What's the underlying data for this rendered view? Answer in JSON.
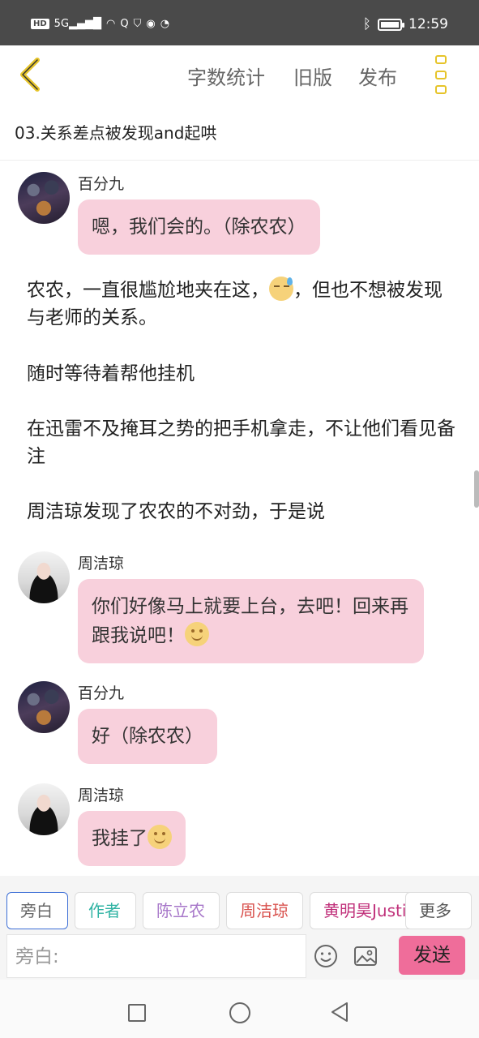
{
  "status_bar": {
    "left_icons": [
      "HD",
      "5G signal",
      "wifi",
      "app-q-icon",
      "shield-icon",
      "browser-icon",
      "search-app-icon"
    ],
    "time": "12:59",
    "right_icons": [
      "bluetooth-icon",
      "battery-icon"
    ]
  },
  "header": {
    "back_icon": "chevron-left-icon",
    "word_count": "字数统计",
    "old_version": "旧版",
    "publish": "发布",
    "more_icon": "vertical-dots-icon",
    "accent": "#e6c42a"
  },
  "chapter_title": "03.关系差点被发现and起哄",
  "messages": [
    {
      "type": "chat",
      "name": "百分九",
      "text": "嗯，我们会的。（除农农）"
    },
    {
      "type": "narration",
      "text_before": "农农，一直很尴尬地夹在这，",
      "emoji": "sweat-emoji",
      "text_after": "，但也不想被发现与老师的关系。"
    },
    {
      "type": "narration",
      "text": "随时等待着帮他挂机"
    },
    {
      "type": "narration",
      "text": "在迅雷不及掩耳之势的把手机拿走，不让他们看见备注"
    },
    {
      "type": "narration",
      "text": "周洁琼发现了农农的不对劲，于是说"
    },
    {
      "type": "chat",
      "name": "周洁琼",
      "text": "你们好像马上就要上台，去吧！回来再跟我说吧！",
      "emoji": "smile-emoji"
    },
    {
      "type": "chat",
      "name": "百分九",
      "text": "好（除农农）"
    },
    {
      "type": "chat",
      "name": "周洁琼",
      "text": "我挂了",
      "emoji": "smile-emoji"
    }
  ],
  "role_chips": [
    {
      "label": "旁白",
      "color": "#666666",
      "active": true
    },
    {
      "label": "作者",
      "color": "#2fb3a3"
    },
    {
      "label": "陈立农",
      "color": "#a777c9"
    },
    {
      "label": "周洁琼",
      "color": "#d9534f"
    },
    {
      "label": "黄明昊Justi",
      "color": "#c0307a"
    },
    {
      "label": "更多",
      "color": "#555555"
    }
  ],
  "composer": {
    "placeholder": "旁白:",
    "emoji_icon": "emoji-icon",
    "image_icon": "image-icon",
    "send_label": "发送",
    "send_color": "#ef6d9a"
  },
  "colors": {
    "bubble": "#f8d0dc",
    "status_bar": "#4a4a4a"
  },
  "nav_bar": [
    "square-icon",
    "circle-home-icon",
    "triangle-back-icon"
  ]
}
